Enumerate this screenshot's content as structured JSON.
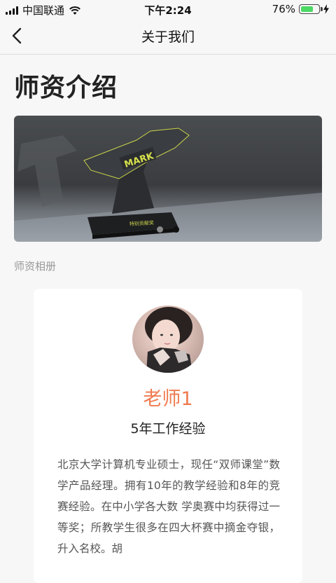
{
  "status_bar": {
    "carrier": "中国联通",
    "time": "下午2:24",
    "battery": "76%",
    "battery_level": 0.76
  },
  "navbar": {
    "title": "关于我们",
    "back_icon": "chevron-left-icon"
  },
  "page_heading": "师资介绍",
  "banner": {
    "trophy_text": "MARK",
    "base_text": "特别贡献奖",
    "slides_count": 2,
    "active_slide": 1
  },
  "section_label": "师资相册",
  "teacher": {
    "name": "老师1",
    "experience": "5年工作经验",
    "bio": "北京大学计算机专业硕士，现任“双师课堂”数学产品经理。拥有10年的教学经验和8年的竞赛经验。在中小学各大数 学奥赛中均获得过一等奖；所教学生很多在四大杯赛中摘金夺银， 升入名校。胡"
  },
  "colors": {
    "accent": "#f07a4f",
    "background": "#f7f7f7",
    "battery": "#4cd964"
  }
}
